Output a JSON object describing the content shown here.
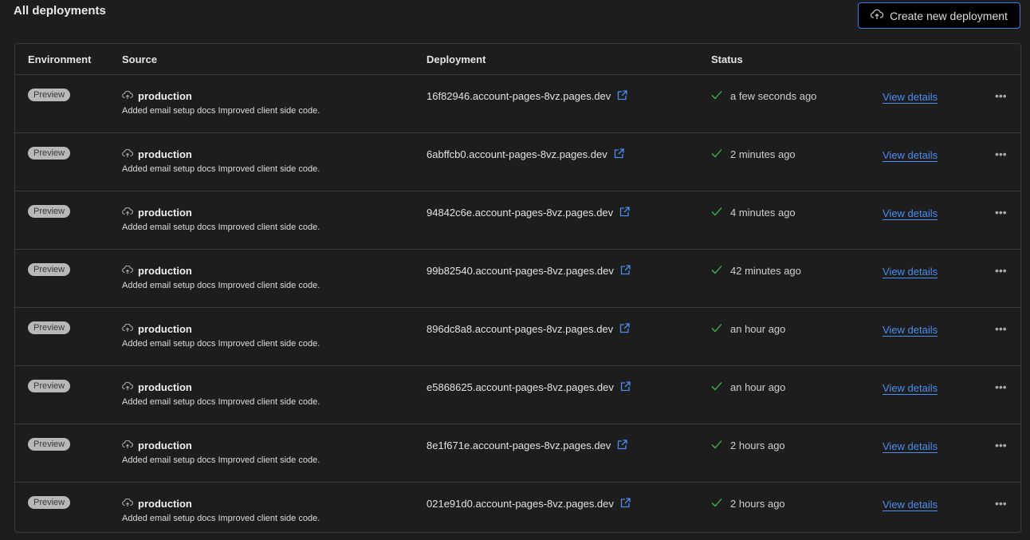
{
  "header": {
    "title": "All deployments",
    "create_label": "Create new deployment"
  },
  "columns": {
    "environment": "Environment",
    "source": "Source",
    "deployment": "Deployment",
    "status": "Status"
  },
  "colors": {
    "accent": "#4b8df0",
    "success": "#3fb950",
    "button_border": "#2f7fe6"
  },
  "rows": [
    {
      "env": "Preview",
      "branch": "production",
      "message": "Added email setup docs Improved client side code.",
      "deployment": "16f82946.account-pages-8vz.pages.dev",
      "status": "a few seconds ago",
      "action": "View details"
    },
    {
      "env": "Preview",
      "branch": "production",
      "message": "Added email setup docs Improved client side code.",
      "deployment": "6abffcb0.account-pages-8vz.pages.dev",
      "status": "2 minutes ago",
      "action": "View details"
    },
    {
      "env": "Preview",
      "branch": "production",
      "message": "Added email setup docs Improved client side code.",
      "deployment": "94842c6e.account-pages-8vz.pages.dev",
      "status": "4 minutes ago",
      "action": "View details"
    },
    {
      "env": "Preview",
      "branch": "production",
      "message": "Added email setup docs Improved client side code.",
      "deployment": "99b82540.account-pages-8vz.pages.dev",
      "status": "42 minutes ago",
      "action": "View details"
    },
    {
      "env": "Preview",
      "branch": "production",
      "message": "Added email setup docs Improved client side code.",
      "deployment": "896dc8a8.account-pages-8vz.pages.dev",
      "status": "an hour ago",
      "action": "View details"
    },
    {
      "env": "Preview",
      "branch": "production",
      "message": "Added email setup docs Improved client side code.",
      "deployment": "e5868625.account-pages-8vz.pages.dev",
      "status": "an hour ago",
      "action": "View details"
    },
    {
      "env": "Preview",
      "branch": "production",
      "message": "Added email setup docs Improved client side code.",
      "deployment": "8e1f671e.account-pages-8vz.pages.dev",
      "status": "2 hours ago",
      "action": "View details"
    },
    {
      "env": "Preview",
      "branch": "production",
      "message": "Added email setup docs Improved client side code.",
      "deployment": "021e91d0.account-pages-8vz.pages.dev",
      "status": "2 hours ago",
      "action": "View details"
    }
  ]
}
